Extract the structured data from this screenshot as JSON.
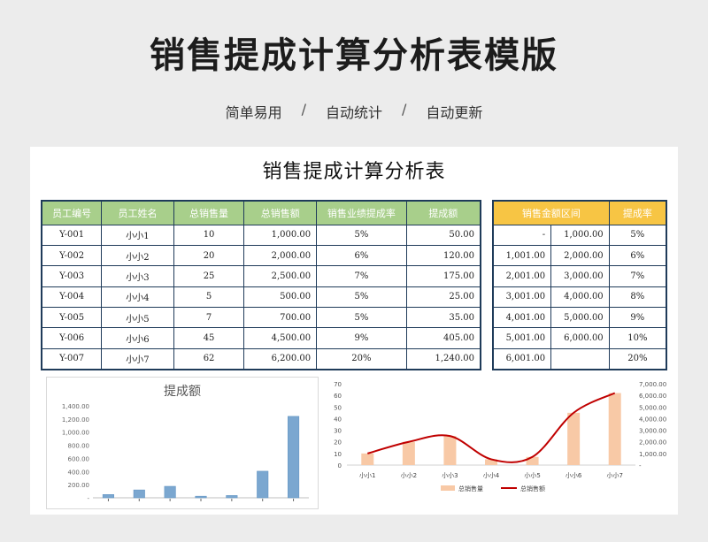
{
  "page": {
    "title": "销售提成计算分析表模版",
    "tags": [
      "简单易用",
      "自动统计",
      "自动更新"
    ],
    "separator": "/"
  },
  "sheet": {
    "title": "销售提成计算分析表",
    "left_table": {
      "headers": [
        "员工编号",
        "员工姓名",
        "总销售量",
        "总销售额",
        "销售业绩提成率",
        "提成额"
      ],
      "rows": [
        [
          "Y-001",
          "小小1",
          "10",
          "1,000.00",
          "5%",
          "50.00"
        ],
        [
          "Y-002",
          "小小2",
          "20",
          "2,000.00",
          "6%",
          "120.00"
        ],
        [
          "Y-003",
          "小小3",
          "25",
          "2,500.00",
          "7%",
          "175.00"
        ],
        [
          "Y-004",
          "小小4",
          "5",
          "500.00",
          "5%",
          "25.00"
        ],
        [
          "Y-005",
          "小小5",
          "7",
          "700.00",
          "5%",
          "35.00"
        ],
        [
          "Y-006",
          "小小6",
          "45",
          "4,500.00",
          "9%",
          "405.00"
        ],
        [
          "Y-007",
          "小小7",
          "62",
          "6,200.00",
          "20%",
          "1,240.00"
        ]
      ]
    },
    "right_table": {
      "headers": [
        "销售金额区间",
        "提成率"
      ],
      "rows": [
        [
          "-",
          "1,000.00",
          "5%"
        ],
        [
          "1,001.00",
          "2,000.00",
          "6%"
        ],
        [
          "2,001.00",
          "3,000.00",
          "7%"
        ],
        [
          "3,001.00",
          "4,000.00",
          "8%"
        ],
        [
          "4,001.00",
          "5,000.00",
          "9%"
        ],
        [
          "5,001.00",
          "6,000.00",
          "10%"
        ],
        [
          "6,001.00",
          "",
          "20%"
        ]
      ]
    }
  },
  "chart_data": [
    {
      "type": "bar",
      "title": "提成额",
      "categories": [
        "小小1",
        "小小2",
        "小小3",
        "小小4",
        "小小5",
        "小小6",
        "小小7"
      ],
      "values": [
        50,
        120,
        175,
        25,
        35,
        405,
        1240
      ],
      "ylim": [
        0,
        1400
      ],
      "yticks": [
        "1,400.00",
        "1,200.00",
        "1,000.00",
        "800.00",
        "600.00",
        "400.00",
        "200.00",
        "-"
      ],
      "color": "#7ba7d0"
    },
    {
      "type": "bar+line",
      "categories": [
        "小小1",
        "小小2",
        "小小3",
        "小小4",
        "小小5",
        "小小6",
        "小小7"
      ],
      "series": [
        {
          "name": "总销售量",
          "type": "bar",
          "axis": "left",
          "values": [
            10,
            20,
            25,
            5,
            7,
            45,
            62
          ],
          "color": "#f8c9a6"
        },
        {
          "name": "总销售额",
          "type": "line",
          "axis": "right",
          "values": [
            1000,
            2000,
            2500,
            500,
            700,
            4500,
            6200
          ],
          "color": "#c00000"
        }
      ],
      "ylim_left": [
        0,
        70
      ],
      "yticks_left": [
        "70",
        "60",
        "50",
        "40",
        "30",
        "20",
        "10",
        "0"
      ],
      "ylim_right": [
        0,
        7000
      ],
      "yticks_right": [
        "7,000.00",
        "6,000.00",
        "5,000.00",
        "4,000.00",
        "3,000.00",
        "2,000.00",
        "1,000.00",
        "-"
      ],
      "legend_position": "bottom"
    }
  ]
}
